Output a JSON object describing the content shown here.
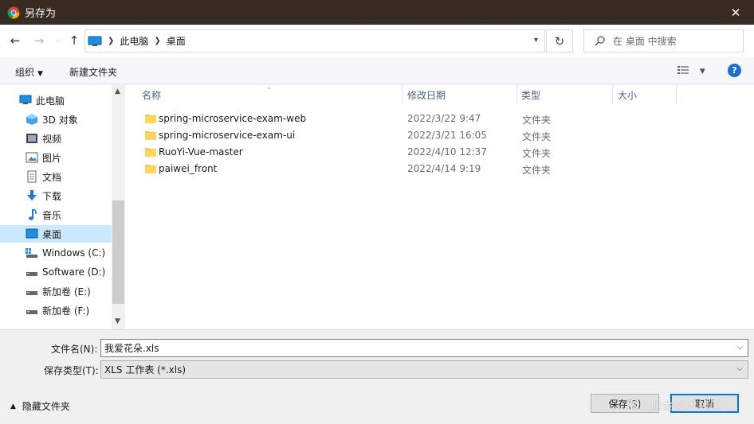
{
  "window": {
    "title": "另存为",
    "close_glyph": "✕"
  },
  "address": {
    "crumbs": [
      "此电脑",
      "桌面"
    ],
    "search_placeholder": "在 桌面 中搜索"
  },
  "toolbar": {
    "organize": "组织",
    "new_folder": "新建文件夹",
    "help": "?"
  },
  "nav": {
    "items": [
      {
        "label": "此电脑",
        "icon": "pc-icon"
      },
      {
        "label": "3D 对象",
        "icon": "3d-objects-icon"
      },
      {
        "label": "视频",
        "icon": "video-icon"
      },
      {
        "label": "图片",
        "icon": "pictures-icon"
      },
      {
        "label": "文档",
        "icon": "documents-icon"
      },
      {
        "label": "下载",
        "icon": "download-icon"
      },
      {
        "label": "音乐",
        "icon": "music-icon"
      },
      {
        "label": "桌面",
        "icon": "desktop-icon",
        "selected": true
      },
      {
        "label": "Windows (C:)",
        "icon": "drive-icon"
      },
      {
        "label": "Software (D:)",
        "icon": "drive-icon"
      },
      {
        "label": "新加卷 (E:)",
        "icon": "drive-icon"
      },
      {
        "label": "新加卷 (F:)",
        "icon": "drive-icon"
      }
    ]
  },
  "files": {
    "columns": {
      "name": "名称",
      "modified": "修改日期",
      "type": "类型",
      "size": "大小"
    },
    "rows": [
      {
        "name": "spring-microservice-exam-web",
        "modified": "2022/3/22 9:47",
        "type": "文件夹"
      },
      {
        "name": "spring-microservice-exam-ui",
        "modified": "2022/3/21 16:05",
        "type": "文件夹"
      },
      {
        "name": "RuoYi-Vue-master",
        "modified": "2022/4/10 12:37",
        "type": "文件夹"
      },
      {
        "name": "paiwei_front",
        "modified": "2022/4/14 9:19",
        "type": "文件夹"
      }
    ]
  },
  "form": {
    "filename_label": "文件名(N):",
    "filename_value": "我爱花朵.xls",
    "filetype_label": "保存类型(T):",
    "filetype_value": "XLS 工作表 (*.xls)",
    "hide_folders": "隐藏文件夹",
    "save": "保存(S)",
    "cancel": "取消"
  },
  "watermark": "稀土掘金技术社区",
  "colors": {
    "titlebar": "#372b22",
    "selection": "#cce8ff",
    "accent": "#0078d7"
  }
}
